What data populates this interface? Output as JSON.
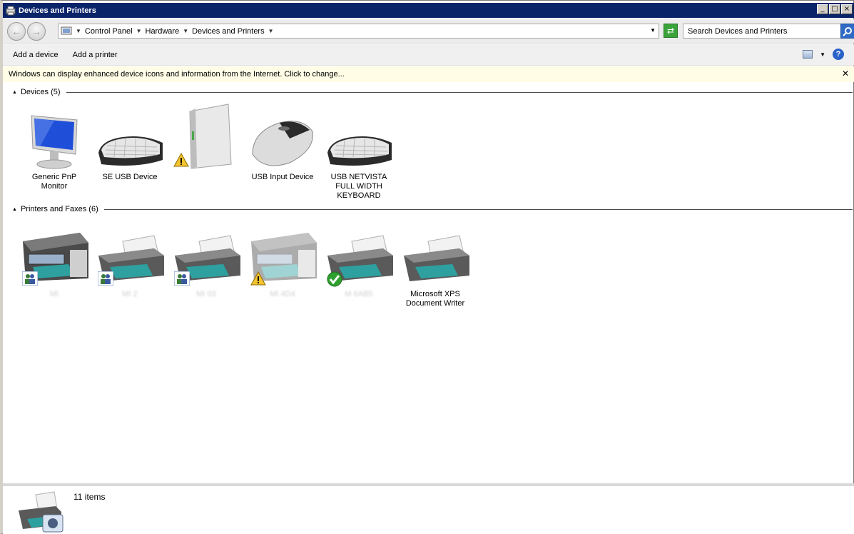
{
  "window": {
    "title": "Devices and Printers"
  },
  "title_controls": {
    "minimize": "_",
    "maximize": "□",
    "close": "×"
  },
  "address": {
    "crumbs": [
      "Control Panel",
      "Hardware",
      "Devices and Printers"
    ]
  },
  "search": {
    "placeholder": "Search Devices and Printers"
  },
  "commands": {
    "add_device": "Add a device",
    "add_printer": "Add a printer"
  },
  "infobar": {
    "text": "Windows can display enhanced device icons and information from the Internet. Click to change..."
  },
  "devices": {
    "header": "Devices (5)",
    "items": [
      {
        "label": "Generic PnP\nMonitor",
        "icon": "monitor-icon"
      },
      {
        "label": "SE USB Device",
        "icon": "keyboard-icon"
      },
      {
        "label": "",
        "icon": "external-drive-icon",
        "badge": "warning"
      },
      {
        "label": "USB Input Device",
        "icon": "mouse-icon"
      },
      {
        "label": "USB NETVISTA\nFULL WIDTH\nKEYBOARD",
        "icon": "keyboard-icon"
      }
    ]
  },
  "printers": {
    "header": "Printers and Faxes (6)",
    "items": [
      {
        "label": "MI",
        "icon": "multifunction-printer-icon",
        "badge": "shared"
      },
      {
        "label": "MI       2",
        "icon": "printer-icon",
        "badge": "shared"
      },
      {
        "label": "MI      03",
        "icon": "printer-icon",
        "badge": "shared"
      },
      {
        "label": "MI      4D4",
        "icon": "multifunction-printer-icon",
        "badge": "warning"
      },
      {
        "label": "M      6AB5",
        "icon": "printer-icon",
        "badge": "default"
      },
      {
        "label": "Microsoft XPS\nDocument Writer",
        "icon": "printer-icon"
      }
    ]
  },
  "status": {
    "count": "11 items"
  },
  "colors": {
    "titlebar": "#0a246a",
    "infobar": "#fffde6",
    "monitor_screen": "#1f4fd8"
  }
}
